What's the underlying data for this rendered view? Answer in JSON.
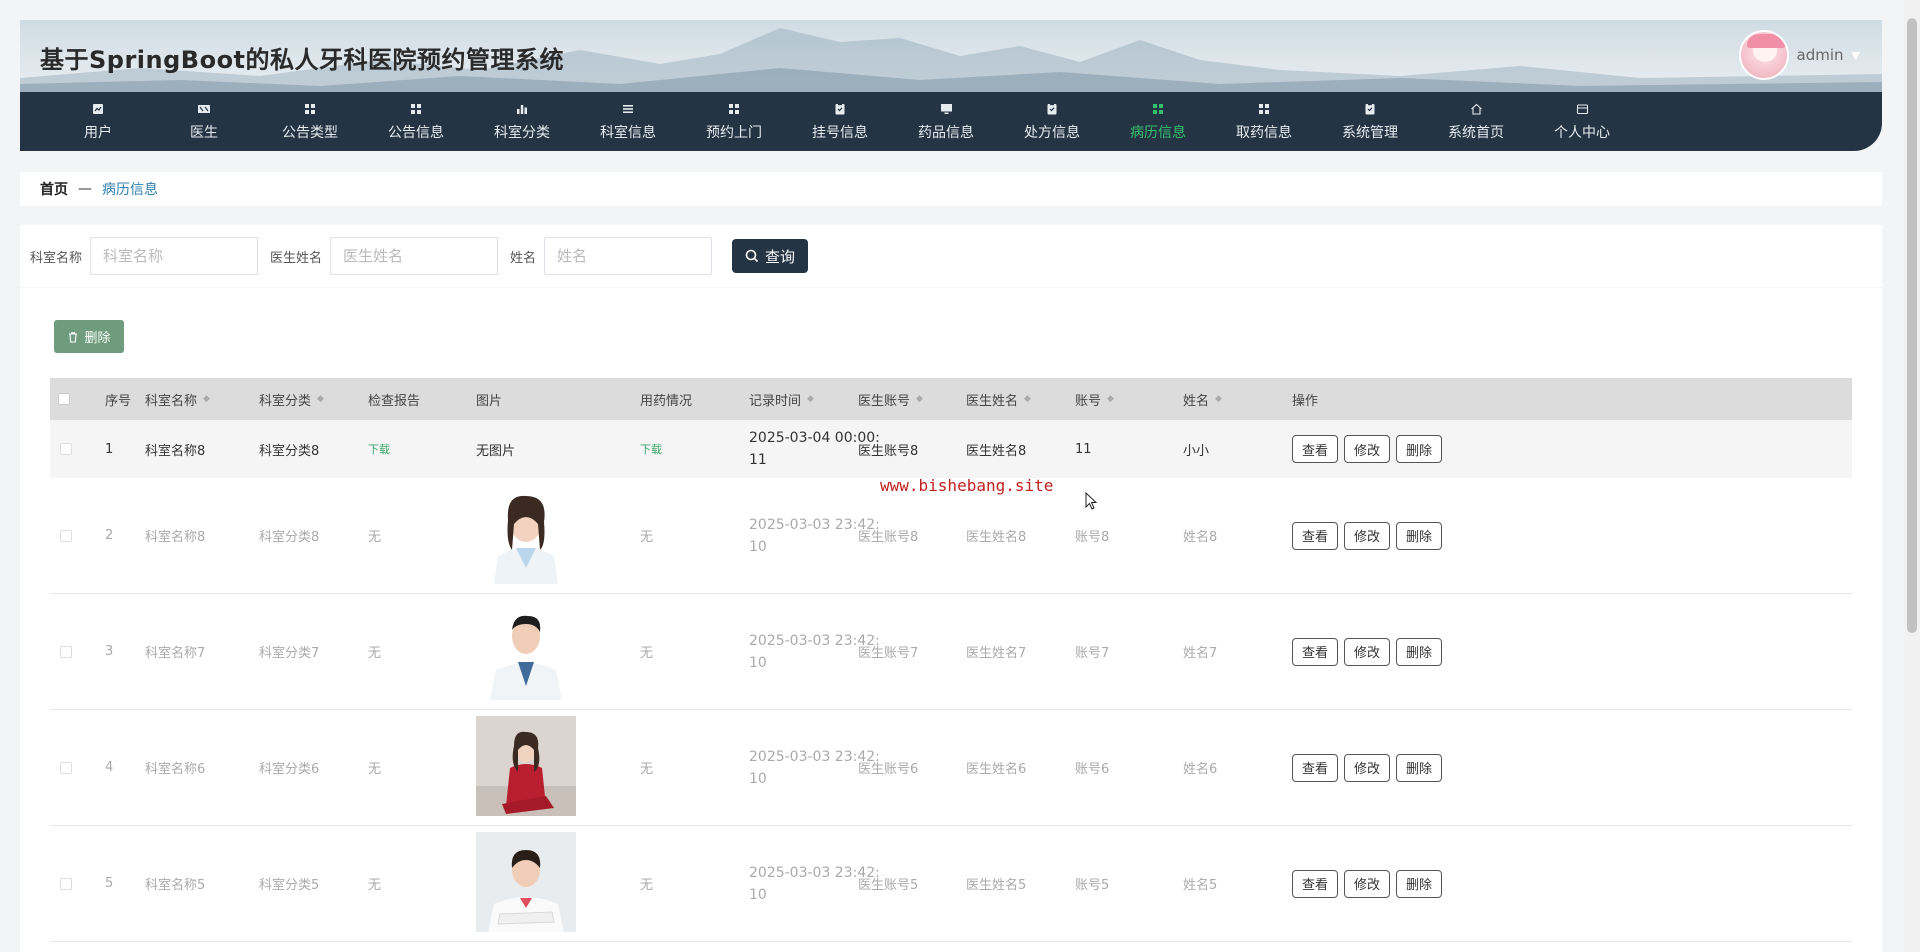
{
  "header": {
    "title": "基于SpringBoot的私人牙科医院预约管理系统",
    "username": "admin"
  },
  "nav": [
    {
      "label": "用户",
      "icon": "chart-icon"
    },
    {
      "label": "医生",
      "icon": "card-icon"
    },
    {
      "label": "公告类型",
      "icon": "grid-icon"
    },
    {
      "label": "公告信息",
      "icon": "grid-icon"
    },
    {
      "label": "科室分类",
      "icon": "bar-chart-icon"
    },
    {
      "label": "科室信息",
      "icon": "list-icon"
    },
    {
      "label": "预约上门",
      "icon": "grid-icon"
    },
    {
      "label": "挂号信息",
      "icon": "clipboard-icon"
    },
    {
      "label": "药品信息",
      "icon": "monitor-icon"
    },
    {
      "label": "处方信息",
      "icon": "clipboard-icon"
    },
    {
      "label": "病历信息",
      "icon": "grid-icon"
    },
    {
      "label": "取药信息",
      "icon": "grid-icon"
    },
    {
      "label": "系统管理",
      "icon": "clipboard-icon"
    },
    {
      "label": "系统首页",
      "icon": "home-icon"
    },
    {
      "label": "个人中心",
      "icon": "wallet-icon"
    }
  ],
  "active_nav": "病历信息",
  "breadcrumb": {
    "home": "首页",
    "separator": "—",
    "current": "病历信息"
  },
  "search": {
    "dept_label": "科室名称",
    "dept_placeholder": "科室名称",
    "doctor_label": "医生姓名",
    "doctor_placeholder": "医生姓名",
    "name_label": "姓名",
    "name_placeholder": "姓名",
    "query_label": "查询"
  },
  "toolbar": {
    "delete_label": "删除"
  },
  "table": {
    "columns": [
      "序号",
      "科室名称",
      "科室分类",
      "检查报告",
      "图片",
      "用药情况",
      "记录时间",
      "医生账号",
      "医生姓名",
      "账号",
      "姓名",
      "操作"
    ],
    "rows": [
      {
        "no": "1",
        "dept": "科室名称8",
        "category": "科室分类8",
        "report": "下载",
        "image": "无图片",
        "medication": "下载",
        "time_line1": "2025-03-04 00:00:",
        "time_line2": "11",
        "doctor_account": "医生账号8",
        "doctor_name": "医生姓名8",
        "account": "11",
        "name": "小小"
      },
      {
        "no": "2",
        "dept": "科室名称8",
        "category": "科室分类8",
        "report": "无",
        "image": "",
        "medication": "无",
        "time_line1": "2025-03-03 23:42:",
        "time_line2": "10",
        "doctor_account": "医生账号8",
        "doctor_name": "医生姓名8",
        "account": "账号8",
        "name": "姓名8"
      },
      {
        "no": "3",
        "dept": "科室名称7",
        "category": "科室分类7",
        "report": "无",
        "image": "",
        "medication": "无",
        "time_line1": "2025-03-03 23:42:",
        "time_line2": "10",
        "doctor_account": "医生账号7",
        "doctor_name": "医生姓名7",
        "account": "账号7",
        "name": "姓名7"
      },
      {
        "no": "4",
        "dept": "科室名称6",
        "category": "科室分类6",
        "report": "无",
        "image": "",
        "medication": "无",
        "time_line1": "2025-03-03 23:42:",
        "time_line2": "10",
        "doctor_account": "医生账号6",
        "doctor_name": "医生姓名6",
        "account": "账号6",
        "name": "姓名6"
      },
      {
        "no": "5",
        "dept": "科室名称5",
        "category": "科室分类5",
        "report": "无",
        "image": "",
        "medication": "无",
        "time_line1": "2025-03-03 23:42:",
        "time_line2": "10",
        "doctor_account": "医生账号5",
        "doctor_name": "医生姓名5",
        "account": "账号5",
        "name": "姓名5"
      }
    ],
    "actions": {
      "view": "查看",
      "edit": "修改",
      "delete": "删除"
    }
  },
  "watermark": "www.bishebang.site",
  "colors": {
    "nav_bg": "#243444",
    "nav_active": "#33c16d",
    "download": "#3aa56e",
    "delete_btn": "#6e9c7c"
  }
}
